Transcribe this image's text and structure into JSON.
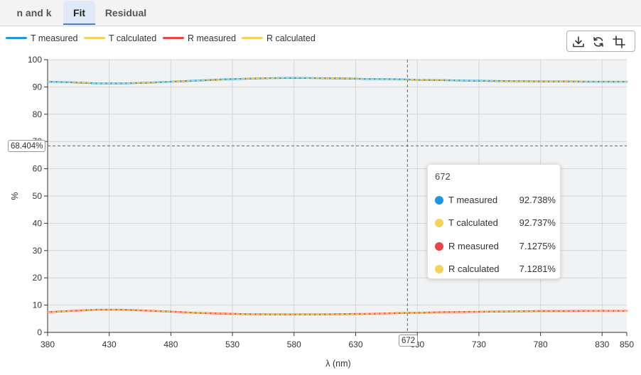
{
  "tabs": [
    {
      "label": "n and k",
      "active": false
    },
    {
      "label": "Fit",
      "active": true
    },
    {
      "label": "Residual",
      "active": false
    }
  ],
  "toolbox": {
    "icons": [
      "download-icon",
      "refresh-icon",
      "crop-icon"
    ]
  },
  "pointer": {
    "y_label": "68.404%",
    "x_label": "672"
  },
  "tooltip": {
    "header": "672",
    "rows": [
      {
        "name": "T measured",
        "value": "92.738%",
        "color": "#1f96e0"
      },
      {
        "name": "T calculated",
        "value": "92.737%",
        "color": "#f5d35a"
      },
      {
        "name": "R measured",
        "value": "7.1275%",
        "color": "#e84545"
      },
      {
        "name": "R calculated",
        "value": "7.1281%",
        "color": "#f5d35a"
      }
    ]
  },
  "chart_data": {
    "type": "line",
    "xlabel": "λ (nm)",
    "ylabel": "%",
    "xlim": [
      380,
      850
    ],
    "ylim": [
      0,
      100
    ],
    "x_ticks": [
      380,
      430,
      480,
      530,
      580,
      630,
      680,
      730,
      780,
      830,
      850
    ],
    "y_ticks": [
      0,
      10,
      20,
      30,
      40,
      50,
      60,
      70,
      80,
      90,
      100
    ],
    "grid": true,
    "legend_position": "top-left",
    "pointer_x": 672,
    "pointer_y": 68.404,
    "x": [
      380,
      400,
      420,
      440,
      460,
      480,
      500,
      520,
      540,
      560,
      580,
      600,
      620,
      640,
      660,
      672,
      680,
      700,
      720,
      740,
      760,
      780,
      800,
      820,
      840,
      850
    ],
    "series": [
      {
        "name": "T measured",
        "color": "#1f96e0",
        "values": [
          91.9,
          91.7,
          91.3,
          91.3,
          91.5,
          91.9,
          92.3,
          92.7,
          93.0,
          93.2,
          93.3,
          93.2,
          93.1,
          92.9,
          92.8,
          92.738,
          92.6,
          92.5,
          92.3,
          92.2,
          92.1,
          92.0,
          92.0,
          91.9,
          91.9,
          91.9
        ]
      },
      {
        "name": "T calculated",
        "color": "#f5d35a",
        "dashed": true,
        "values": [
          91.9,
          91.7,
          91.3,
          91.3,
          91.5,
          91.9,
          92.3,
          92.7,
          93.0,
          93.2,
          93.3,
          93.2,
          93.1,
          92.9,
          92.8,
          92.737,
          92.6,
          92.5,
          92.3,
          92.2,
          92.1,
          92.0,
          92.0,
          91.9,
          91.9,
          91.9
        ]
      },
      {
        "name": "R measured",
        "color": "#e84545",
        "values": [
          7.4,
          7.9,
          8.3,
          8.3,
          8.0,
          7.6,
          7.2,
          6.9,
          6.7,
          6.6,
          6.6,
          6.6,
          6.7,
          6.8,
          7.0,
          7.1275,
          7.2,
          7.4,
          7.5,
          7.6,
          7.7,
          7.8,
          7.8,
          7.9,
          7.9,
          7.9
        ]
      },
      {
        "name": "R calculated",
        "color": "#f5d35a",
        "dashed": true,
        "values": [
          7.4,
          7.9,
          8.3,
          8.3,
          8.0,
          7.6,
          7.2,
          6.9,
          6.7,
          6.6,
          6.6,
          6.6,
          6.7,
          6.8,
          7.0,
          7.1281,
          7.2,
          7.4,
          7.5,
          7.6,
          7.7,
          7.8,
          7.8,
          7.9,
          7.9,
          7.9
        ]
      }
    ]
  }
}
